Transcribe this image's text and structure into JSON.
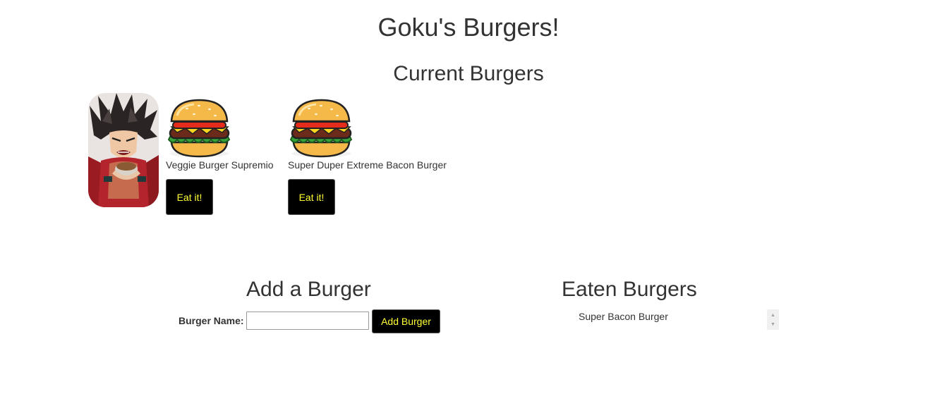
{
  "header": {
    "title": "Goku's Burgers!"
  },
  "current": {
    "title": "Current Burgers",
    "burgers": [
      {
        "name": "Veggie Burger Supremio",
        "button_label": "Eat it!"
      },
      {
        "name": "Super Duper Extreme Bacon Burger",
        "button_label": "Eat it!"
      }
    ]
  },
  "add_form": {
    "title": "Add a Burger",
    "label": "Burger Name:",
    "input_value": "",
    "button_label": "Add Burger"
  },
  "eaten": {
    "title": "Eaten Burgers",
    "items": [
      "Super Bacon Burger"
    ]
  },
  "colors": {
    "button_bg": "#000000",
    "button_text": "#ffff33",
    "text": "#333333"
  },
  "icons": {
    "burger": "burger-icon",
    "mascot": "goku-mascot-image",
    "scroll_up": "scroll-up-arrow-icon",
    "scroll_down": "scroll-down-arrow-icon"
  }
}
